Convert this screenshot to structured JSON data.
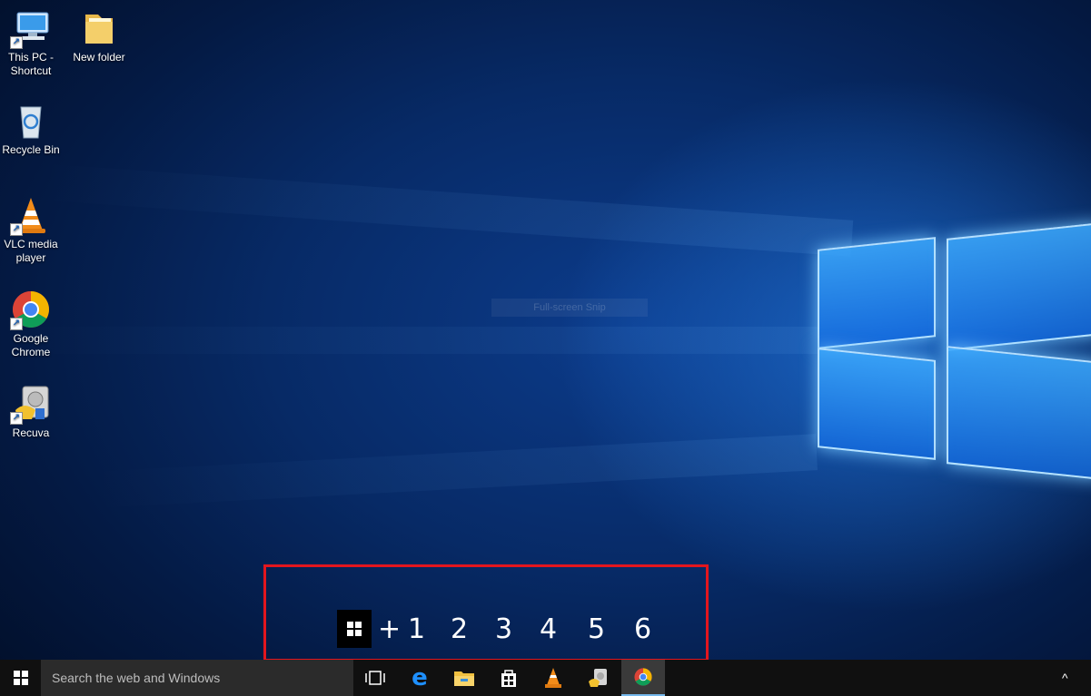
{
  "desktop": {
    "icons": [
      {
        "label": "This PC - Shortcut",
        "icon": "computer-icon",
        "shortcut": true
      },
      {
        "label": "New folder",
        "icon": "folder-icon",
        "shortcut": false
      },
      {
        "label": "Recycle Bin",
        "icon": "recycle-bin-icon",
        "shortcut": false
      },
      {
        "label": "VLC media player",
        "icon": "vlc-cone-icon",
        "shortcut": true
      },
      {
        "label": "Google Chrome",
        "icon": "chrome-icon",
        "shortcut": true
      },
      {
        "label": "Recuva",
        "icon": "recuva-icon",
        "shortcut": true
      }
    ],
    "ghost_label": "Full-screen Snip"
  },
  "hotkey": {
    "plus": "+",
    "numbers": [
      "1",
      "2",
      "3",
      "4",
      "5",
      "6"
    ],
    "highlight_color": "#e3161e"
  },
  "taskbar": {
    "search_placeholder": "Search the web and Windows",
    "pinned": [
      {
        "name": "task-view-icon"
      },
      {
        "name": "edge-icon"
      },
      {
        "name": "file-explorer-icon"
      },
      {
        "name": "store-icon"
      },
      {
        "name": "vlc-cone-icon"
      },
      {
        "name": "recuva-icon"
      },
      {
        "name": "chrome-icon",
        "active": true
      }
    ],
    "tray_chevron": "^"
  }
}
